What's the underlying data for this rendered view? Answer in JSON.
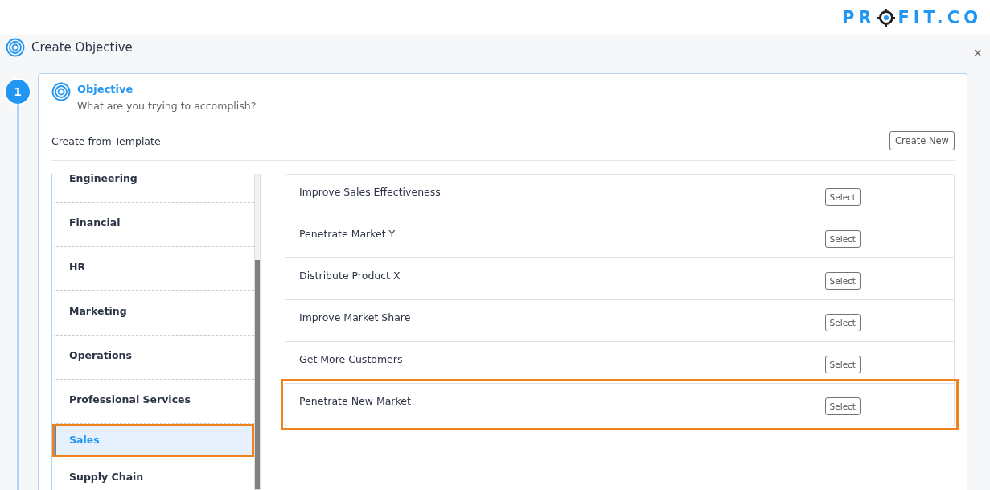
{
  "logo": {
    "text_before_mark": "PR",
    "text_after_mark": "FIT.CO"
  },
  "dialog": {
    "title": "Create Objective",
    "close": "×"
  },
  "step": {
    "number": "1",
    "title": "Objective",
    "subtitle": "What are you trying to accomplish?"
  },
  "template_section": {
    "label": "Create from Template",
    "create_button": "Create New"
  },
  "categories": [
    {
      "label": "Engineering",
      "selected": false,
      "highlighted": false
    },
    {
      "label": "Financial",
      "selected": false,
      "highlighted": false
    },
    {
      "label": "HR",
      "selected": false,
      "highlighted": false
    },
    {
      "label": "Marketing",
      "selected": false,
      "highlighted": false
    },
    {
      "label": "Operations",
      "selected": false,
      "highlighted": false
    },
    {
      "label": "Professional Services",
      "selected": false,
      "highlighted": false
    },
    {
      "label": "Sales",
      "selected": true,
      "highlighted": true
    },
    {
      "label": "Supply Chain",
      "selected": false,
      "highlighted": false
    }
  ],
  "templates": [
    {
      "title": "Improve Sales Effectiveness",
      "button": "Select",
      "highlighted": false
    },
    {
      "title": "Penetrate Market Y",
      "button": "Select",
      "highlighted": false
    },
    {
      "title": "Distribute Product X",
      "button": "Select",
      "highlighted": false
    },
    {
      "title": "Improve Market Share",
      "button": "Select",
      "highlighted": false
    },
    {
      "title": "Get More Customers",
      "button": "Select",
      "highlighted": false
    },
    {
      "title": "Penetrate New Market",
      "button": "Select",
      "highlighted": true
    }
  ]
}
